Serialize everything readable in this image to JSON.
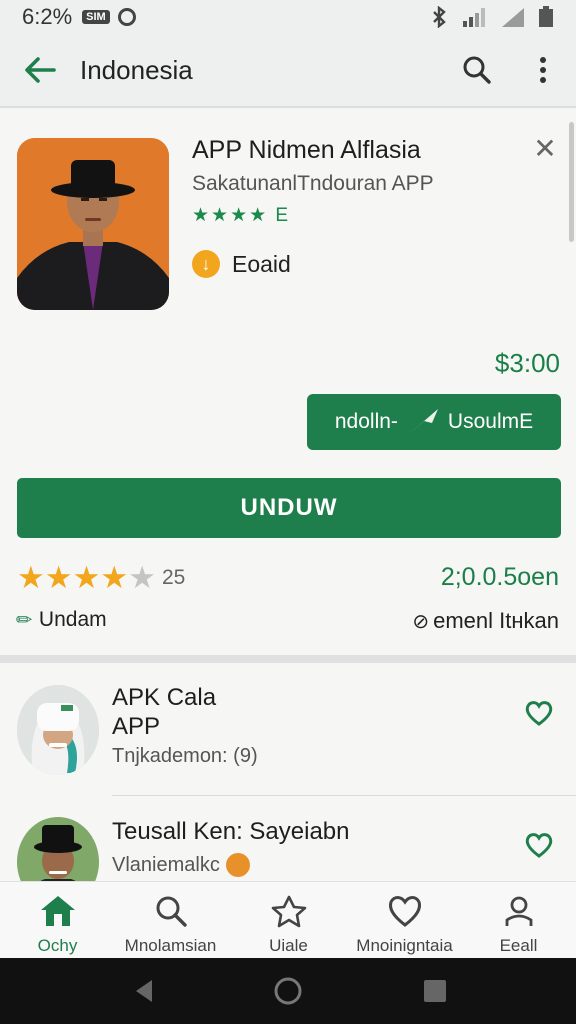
{
  "status_bar": {
    "time": "6:2%",
    "badge": "SIM"
  },
  "app_bar": {
    "title": "Indonesia"
  },
  "app": {
    "name": "APP Nidmen Alflasia",
    "developer": "SakatunanlTndouran APP",
    "stars_text": "★★★★ E",
    "paid_label": "Eoaid",
    "price": "$3:00",
    "download_button": {
      "left": "ndolln-",
      "right": "UsoulmE"
    },
    "install_label": "UNDUW",
    "rating_value": 4,
    "rating_count": "25",
    "downloads": "2;0.0.5oen",
    "tag_left": "Undam",
    "tag_right": "emenl Itнkan"
  },
  "list": [
    {
      "title_line1": "APK Cala",
      "title_line2": "APP",
      "subtitle": "Tnjkademon: (9)"
    },
    {
      "title_line1": "Teusall Ken: Sayeiabn",
      "title_line2": "",
      "subtitle": "Vlaniemalkc"
    }
  ],
  "bottom_nav": [
    {
      "label": "Ochy",
      "icon": "home-icon",
      "active": true
    },
    {
      "label": "Mnolamsian",
      "icon": "search-icon",
      "active": false
    },
    {
      "label": "Uiale",
      "icon": "star-icon",
      "active": false
    },
    {
      "label": "Mnoinigntaia",
      "icon": "heart-icon",
      "active": false
    },
    {
      "label": "Eeall",
      "icon": "person-icon",
      "active": false
    }
  ],
  "colors": {
    "accent": "#1f7f4c",
    "star": "#f2a61d"
  }
}
